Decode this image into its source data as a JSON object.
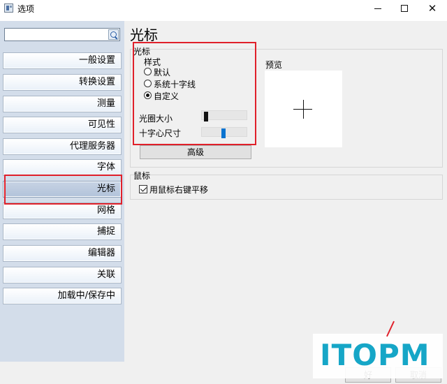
{
  "window": {
    "title": "选项",
    "close_glyph": "✕"
  },
  "search": {
    "value": "",
    "placeholder": ""
  },
  "sidebar": {
    "items": [
      {
        "label": "一般设置"
      },
      {
        "label": "转换设置"
      },
      {
        "label": "测量"
      },
      {
        "label": "可见性"
      },
      {
        "label": "代理服务器"
      },
      {
        "label": "字体"
      },
      {
        "label": "光标",
        "selected": true
      },
      {
        "label": "网格"
      },
      {
        "label": "捕捉"
      },
      {
        "label": "编辑器"
      },
      {
        "label": "关联"
      },
      {
        "label": "加载中/保存中"
      }
    ]
  },
  "page": {
    "title": "光标",
    "cursor_group": {
      "label": "光标",
      "style_label": "样式",
      "options": [
        "默认",
        "系统十字线",
        "自定义"
      ],
      "selected_option": "自定义",
      "aperture_label": "光圈大小",
      "aperture_level": 0.05,
      "crosshair_label": "十字心尺寸",
      "crosshair_level": 0.48,
      "advanced_button": "高级",
      "preview_label": "预览"
    },
    "mouse_group": {
      "label": "鼠标",
      "pan_checkbox_label": "用鼠标右键平移",
      "pan_checked": true
    }
  },
  "footer": {
    "ok_label": "好",
    "cancel_label": "取消"
  },
  "watermark": {
    "text": "ITOPM"
  },
  "colors": {
    "highlight_box": "#e0202a",
    "selected_nav": "#b2c3da",
    "slider_blue": "#0a73d0",
    "watermark": "#16a6c7"
  }
}
